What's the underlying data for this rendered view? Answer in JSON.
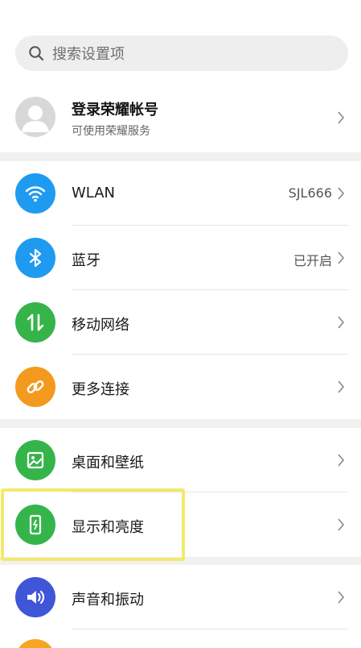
{
  "search": {
    "placeholder": "搜索设置项"
  },
  "account": {
    "title": "登录荣耀帐号",
    "subtitle": "可使用荣耀服务"
  },
  "groups": [
    {
      "items": [
        {
          "label": "WLAN",
          "value": "SJL666",
          "icon": "wifi-icon",
          "color": "#1e9bf0"
        },
        {
          "label": "蓝牙",
          "value": "已开启",
          "icon": "bluetooth-icon",
          "color": "#1e9bf0"
        },
        {
          "label": "移动网络",
          "value": "",
          "icon": "mobile-data-icon",
          "color": "#35b44a"
        },
        {
          "label": "更多连接",
          "value": "",
          "icon": "link-icon",
          "color": "#f39a1e"
        }
      ]
    },
    {
      "items": [
        {
          "label": "桌面和壁纸",
          "value": "",
          "icon": "wallpaper-icon",
          "color": "#35b44a"
        },
        {
          "label": "显示和亮度",
          "value": "",
          "icon": "display-brightness-icon",
          "color": "#35b44a"
        }
      ]
    },
    {
      "items": [
        {
          "label": "声音和振动",
          "value": "",
          "icon": "sound-icon",
          "color": "#3f56d8"
        }
      ]
    }
  ],
  "highlight_color": "#f2ea6a"
}
